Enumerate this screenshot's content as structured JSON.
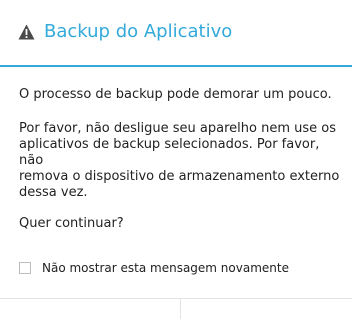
{
  "dialog": {
    "title": "Backup do Aplicativo",
    "title_icon": "warning-icon",
    "accent_color": "#33aada",
    "message_1": "O processo de backup pode demorar um pouco.",
    "message_2_lines": [
      "Por favor, não desligue seu aparelho nem use os",
      "aplicativos de backup selecionados. Por favor, não",
      "remova o dispositivo de armazenamento externo",
      "dessa vez."
    ],
    "question": "Quer continuar?",
    "checkbox": {
      "label": "Não mostrar esta mensagem novamente",
      "checked": false
    },
    "buttons": {
      "left_label": "",
      "right_label": ""
    }
  }
}
